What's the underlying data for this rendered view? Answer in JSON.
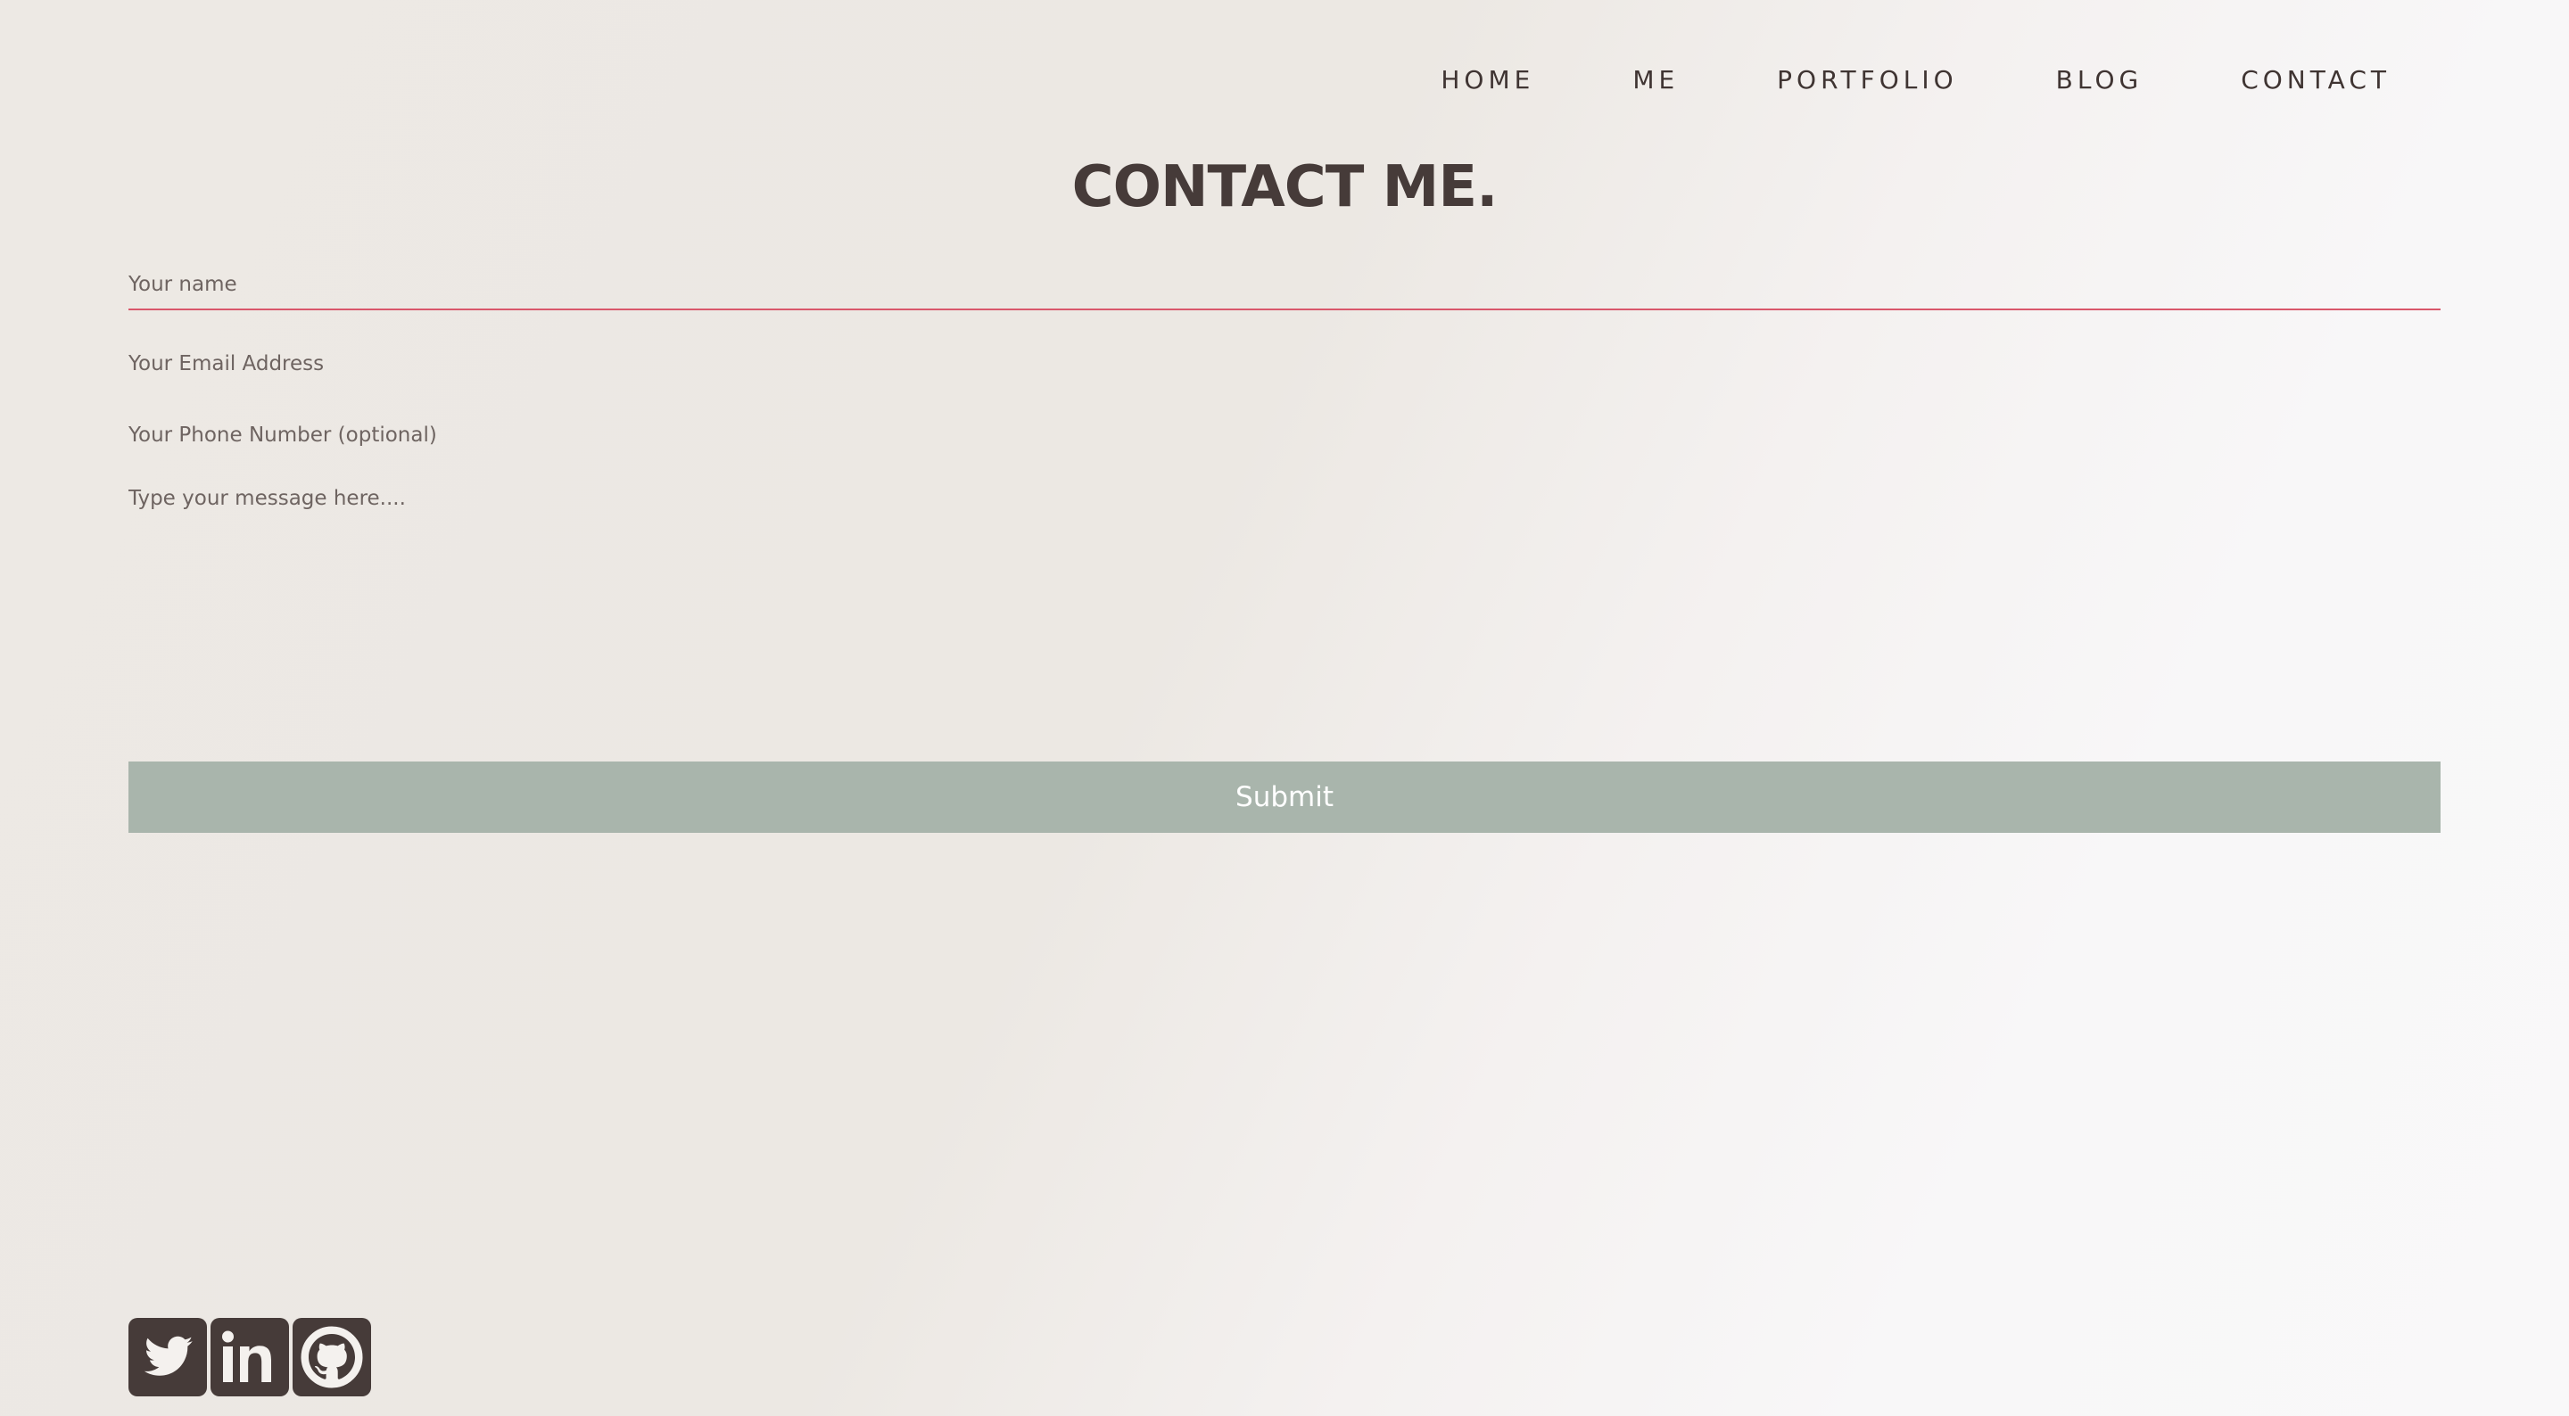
{
  "nav": {
    "items": [
      {
        "label": "HOME"
      },
      {
        "label": "ME"
      },
      {
        "label": "PORTFOLIO"
      },
      {
        "label": "BLOG"
      },
      {
        "label": "CONTACT"
      }
    ]
  },
  "page": {
    "title": "CONTACT ME."
  },
  "form": {
    "name_placeholder": "Your name",
    "email_placeholder": "Your Email Address",
    "phone_placeholder": "Your Phone Number (optional)",
    "message_placeholder": "Type your message here....",
    "submit_label": "Submit"
  },
  "social": {
    "icons": [
      "twitter-icon",
      "linkedin-icon",
      "github-icon"
    ]
  },
  "colors": {
    "text": "#463b39",
    "accent_underline": "#d9576b",
    "submit_bg": "#a9b5ac",
    "icon_bg": "#463b39"
  }
}
